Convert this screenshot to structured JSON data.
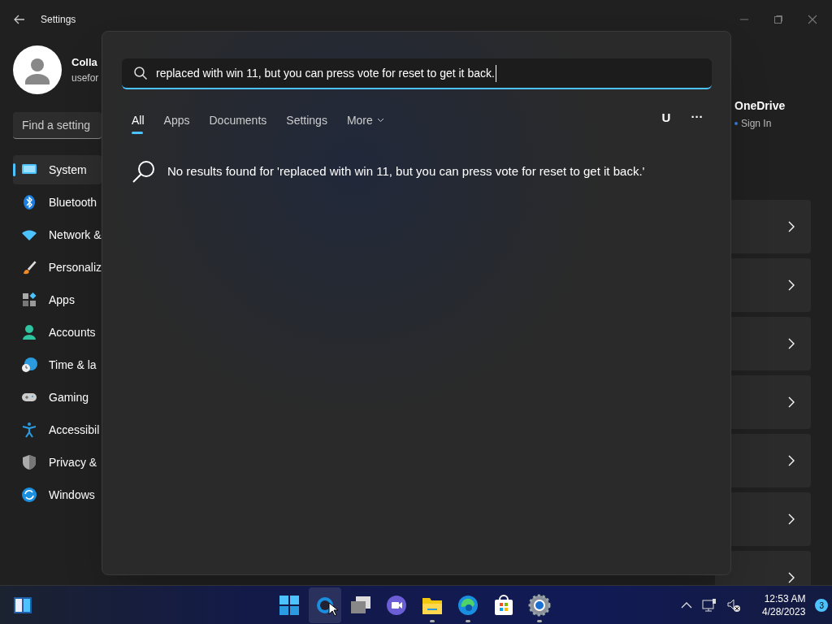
{
  "window": {
    "title": "Settings"
  },
  "account": {
    "name": "Colla",
    "email": "usefor"
  },
  "find_setting": {
    "placeholder": "Find a setting"
  },
  "sidebar": {
    "items": [
      {
        "label": "System",
        "selected": true
      },
      {
        "label": "Bluetooth",
        "selected": false
      },
      {
        "label": "Network &",
        "selected": false
      },
      {
        "label": "Personaliz",
        "selected": false
      },
      {
        "label": "Apps",
        "selected": false
      },
      {
        "label": "Accounts",
        "selected": false
      },
      {
        "label": "Time & la",
        "selected": false
      },
      {
        "label": "Gaming",
        "selected": false
      },
      {
        "label": "Accessibil",
        "selected": false
      },
      {
        "label": "Privacy &",
        "selected": false
      },
      {
        "label": "Windows",
        "selected": false
      }
    ]
  },
  "onedrive": {
    "title": "OneDrive",
    "status": "Sign In",
    "color": "#3a7bd5"
  },
  "search": {
    "value": "replaced with win 11, but you can press vote for reset to get it back.",
    "tabs": [
      {
        "label": "All",
        "selected": true,
        "kind": "tab"
      },
      {
        "label": "Apps",
        "selected": false,
        "kind": "tab"
      },
      {
        "label": "Documents",
        "selected": false,
        "kind": "tab"
      },
      {
        "label": "Settings",
        "selected": false,
        "kind": "tab"
      },
      {
        "label": "More",
        "selected": false,
        "kind": "dropdown"
      }
    ],
    "user_initial": "U",
    "more_options": "···",
    "no_results": "No results found for 'replaced with win 11, but you can press vote for reset to get it back.'"
  },
  "taskbar": {
    "apps": [
      {
        "running": false,
        "hovered": false
      },
      {
        "running": false,
        "hovered": true
      },
      {
        "running": false,
        "hovered": false
      },
      {
        "running": false,
        "hovered": false
      },
      {
        "running": true,
        "hovered": false
      },
      {
        "running": true,
        "hovered": false
      },
      {
        "running": false,
        "hovered": false
      },
      {
        "running": true,
        "hovered": false
      }
    ],
    "time": "12:53 AM",
    "date": "4/28/2023",
    "notifications": "3"
  }
}
